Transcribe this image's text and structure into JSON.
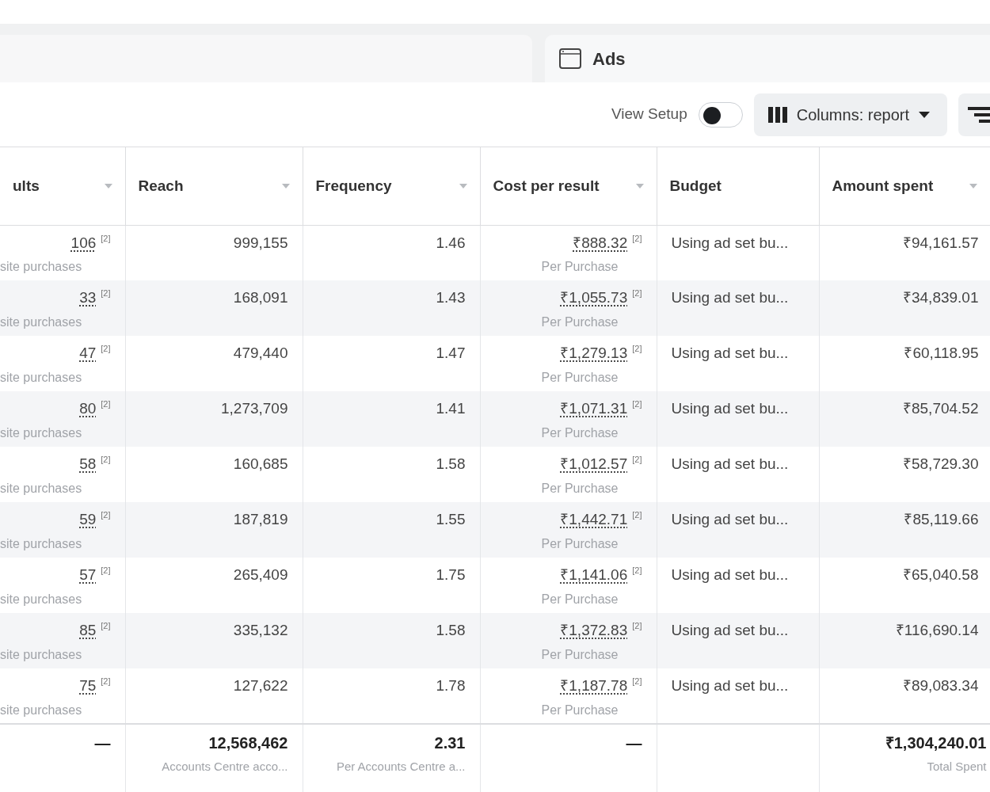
{
  "tabs": [
    {
      "label": "Ads",
      "selected": true
    }
  ],
  "toolbar": {
    "view_setup": {
      "label": "View Setup",
      "on": false
    },
    "columns_button": {
      "label": "Columns: report"
    }
  },
  "table": {
    "columns": [
      {
        "label": "ults",
        "sortable": true
      },
      {
        "label": "Reach",
        "sortable": true
      },
      {
        "label": "Frequency",
        "sortable": true
      },
      {
        "label": "Cost per result",
        "sortable": true
      },
      {
        "label": "Budget",
        "sortable": false
      },
      {
        "label": "Amount spent",
        "sortable": true
      }
    ],
    "rows": [
      {
        "results": "106",
        "results_note": "[2]",
        "results_sub": "site purchases",
        "reach": "999,155",
        "frequency": "1.46",
        "cost": "₹888.32",
        "cost_note": "[2]",
        "cost_sub": "Per Purchase",
        "budget": "Using ad set bu...",
        "spent": "₹94,161.57"
      },
      {
        "results": "33",
        "results_note": "[2]",
        "results_sub": "site purchases",
        "reach": "168,091",
        "frequency": "1.43",
        "cost": "₹1,055.73",
        "cost_note": "[2]",
        "cost_sub": "Per Purchase",
        "budget": "Using ad set bu...",
        "spent": "₹34,839.01"
      },
      {
        "results": "47",
        "results_note": "[2]",
        "results_sub": "site purchases",
        "reach": "479,440",
        "frequency": "1.47",
        "cost": "₹1,279.13",
        "cost_note": "[2]",
        "cost_sub": "Per Purchase",
        "budget": "Using ad set bu...",
        "spent": "₹60,118.95"
      },
      {
        "results": "80",
        "results_note": "[2]",
        "results_sub": "site purchases",
        "reach": "1,273,709",
        "frequency": "1.41",
        "cost": "₹1,071.31",
        "cost_note": "[2]",
        "cost_sub": "Per Purchase",
        "budget": "Using ad set bu...",
        "spent": "₹85,704.52"
      },
      {
        "results": "58",
        "results_note": "[2]",
        "results_sub": "site purchases",
        "reach": "160,685",
        "frequency": "1.58",
        "cost": "₹1,012.57",
        "cost_note": "[2]",
        "cost_sub": "Per Purchase",
        "budget": "Using ad set bu...",
        "spent": "₹58,729.30"
      },
      {
        "results": "59",
        "results_note": "[2]",
        "results_sub": "site purchases",
        "reach": "187,819",
        "frequency": "1.55",
        "cost": "₹1,442.71",
        "cost_note": "[2]",
        "cost_sub": "Per Purchase",
        "budget": "Using ad set bu...",
        "spent": "₹85,119.66"
      },
      {
        "results": "57",
        "results_note": "[2]",
        "results_sub": "site purchases",
        "reach": "265,409",
        "frequency": "1.75",
        "cost": "₹1,141.06",
        "cost_note": "[2]",
        "cost_sub": "Per Purchase",
        "budget": "Using ad set bu...",
        "spent": "₹65,040.58"
      },
      {
        "results": "85",
        "results_note": "[2]",
        "results_sub": "site purchases",
        "reach": "335,132",
        "frequency": "1.58",
        "cost": "₹1,372.83",
        "cost_note": "[2]",
        "cost_sub": "Per Purchase",
        "budget": "Using ad set bu...",
        "spent": "₹116,690.14"
      },
      {
        "results": "75",
        "results_note": "[2]",
        "results_sub": "site purchases",
        "reach": "127,622",
        "frequency": "1.78",
        "cost": "₹1,187.78",
        "cost_note": "[2]",
        "cost_sub": "Per Purchase",
        "budget": "Using ad set bu...",
        "spent": "₹89,083.34"
      }
    ],
    "totals": {
      "results": "—",
      "reach": "12,568,462",
      "reach_sub": "Accounts Centre acco...",
      "frequency": "2.31",
      "frequency_sub": "Per Accounts Centre a...",
      "cost": "—",
      "spent": "₹1,304,240.01",
      "spent_sub": "Total Spent"
    }
  }
}
